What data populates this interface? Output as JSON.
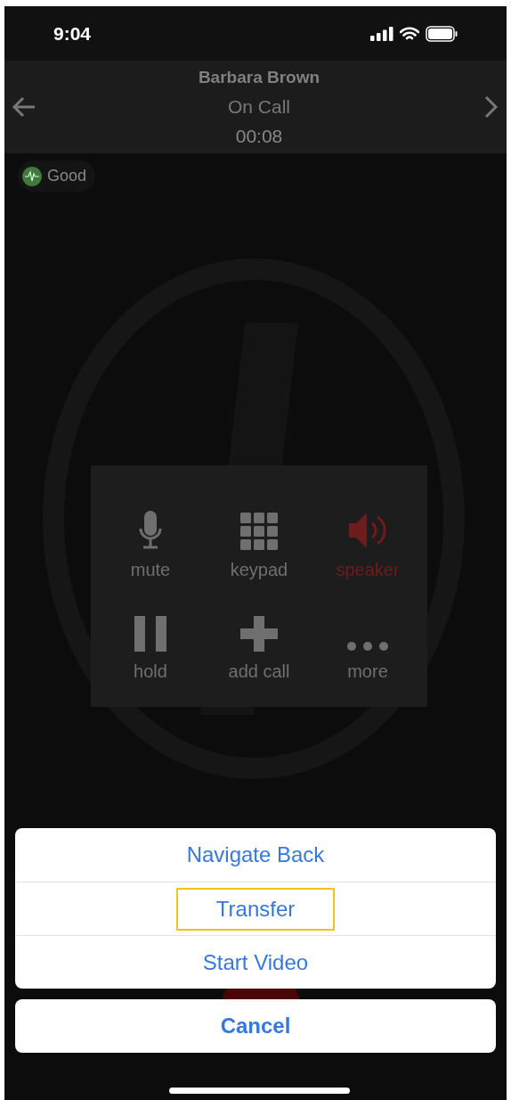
{
  "status_bar": {
    "time": "9:04"
  },
  "header": {
    "name": "Barbara Brown",
    "status": "On Call",
    "duration": "00:08"
  },
  "quality": {
    "label": "Good",
    "color": "#3f7a3a"
  },
  "controls": [
    {
      "kind": "mic",
      "label": "mute",
      "on": false
    },
    {
      "kind": "keypad",
      "label": "keypad",
      "on": false
    },
    {
      "kind": "speaker",
      "label": "speaker",
      "on": true
    },
    {
      "kind": "pause",
      "label": "hold",
      "on": false
    },
    {
      "kind": "plus",
      "label": "add call",
      "on": false
    },
    {
      "kind": "dots",
      "label": "more",
      "on": false
    }
  ],
  "action_sheet": {
    "items": [
      {
        "label": "Navigate Back",
        "highlighted": false
      },
      {
        "label": "Transfer",
        "highlighted": true
      },
      {
        "label": "Start Video",
        "highlighted": false
      }
    ],
    "cancel": "Cancel"
  }
}
